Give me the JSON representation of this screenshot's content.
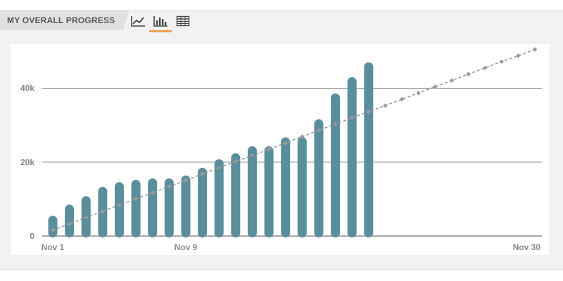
{
  "header": {
    "title": "MY OVERALL PROGRESS"
  },
  "toolbar": {
    "buttons": [
      {
        "icon": "line-chart-icon",
        "active": false
      },
      {
        "icon": "bar-chart-icon",
        "active": true
      },
      {
        "icon": "table-icon",
        "active": false
      }
    ]
  },
  "colors": {
    "bar": "#5a8e9c",
    "target_line": "#999999",
    "grid": "#8a8a8a",
    "accent": "#f0a050"
  },
  "chart_data": {
    "type": "bar",
    "ylim": [
      0,
      50000
    ],
    "xlim": [
      1,
      30
    ],
    "yticks": [
      {
        "value": 0,
        "label": "0"
      },
      {
        "value": 20000,
        "label": "20k"
      },
      {
        "value": 40000,
        "label": "40k"
      }
    ],
    "xticks": [
      {
        "value": 1,
        "label": "Nov 1"
      },
      {
        "value": 9,
        "label": "Nov 9"
      },
      {
        "value": 30,
        "label": "Nov 30"
      }
    ],
    "series": [
      {
        "kind": "bar",
        "x": [
          1,
          2,
          3,
          4,
          5,
          6,
          7,
          8,
          9,
          10,
          11,
          12,
          13,
          14,
          15,
          16,
          17,
          18,
          19,
          20
        ],
        "values": [
          5500,
          8500,
          10800,
          13300,
          14600,
          15200,
          15600,
          15600,
          16400,
          18500,
          20800,
          22400,
          24300,
          24300,
          26700,
          26800,
          31600,
          38600,
          43000,
          47000
        ]
      },
      {
        "kind": "line",
        "style": "dashed",
        "x": [
          1,
          2,
          3,
          4,
          5,
          6,
          7,
          8,
          9,
          10,
          11,
          12,
          13,
          14,
          15,
          16,
          17,
          18,
          19,
          20,
          21,
          22,
          23,
          24,
          25,
          26,
          27,
          28,
          29,
          30
        ],
        "values": [
          1600,
          3300,
          5000,
          6700,
          8400,
          10100,
          11700,
          13400,
          15100,
          16800,
          18500,
          20200,
          21800,
          23500,
          25200,
          26900,
          28600,
          30300,
          32000,
          33700,
          35300,
          37000,
          38700,
          40400,
          42100,
          43800,
          45500,
          47200,
          48800,
          50500
        ]
      }
    ]
  }
}
